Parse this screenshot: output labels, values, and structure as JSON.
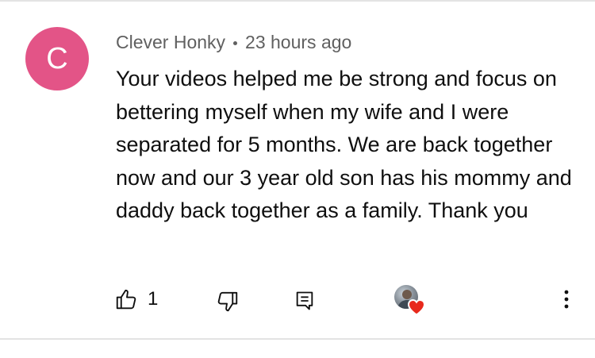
{
  "comment": {
    "avatar_letter": "C",
    "avatar_color": "#e35487",
    "author": "Clever Honky",
    "separator": "•",
    "timestamp": "23 hours ago",
    "text": "Your videos helped me be strong and focus on bettering myself when my wife and I were separated for 5 months. We are back together now and our 3 year old son has his mommy and daddy back together as a family. Thank you"
  },
  "actions": {
    "like_icon": "thumbs-up-icon",
    "like_count": "1",
    "dislike_icon": "thumbs-down-icon",
    "reply_icon": "reply-comment-icon",
    "hearted_icon": "creator-heart-icon",
    "heart_color": "#e8291c",
    "more_icon": "more-vertical-icon"
  }
}
